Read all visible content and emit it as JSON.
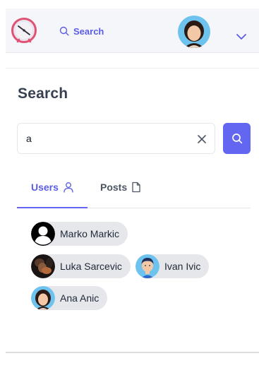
{
  "navbar": {
    "logo_icon": "clock-icon",
    "search_label": "Search",
    "search_icon": "search-icon",
    "avatar_icon": "user-avatar",
    "menu_icon": "chevron-down-icon"
  },
  "page": {
    "title": "Search"
  },
  "search": {
    "value": "a",
    "placeholder": "",
    "clear_icon": "close-icon",
    "submit_icon": "search-icon"
  },
  "tabs": [
    {
      "label": "Users",
      "icon": "user-icon",
      "active": true
    },
    {
      "label": "Posts",
      "icon": "document-icon",
      "active": false
    }
  ],
  "results": [
    {
      "name": "Marko Markic",
      "avatar": "default-avatar"
    },
    {
      "name": "Luka Sarcevic",
      "avatar": "photo-avatar"
    },
    {
      "name": "Ivan Ivic",
      "avatar": "cartoon-boy-avatar"
    },
    {
      "name": "Ana Anic",
      "avatar": "cartoon-girl-avatar"
    }
  ],
  "colors": {
    "accent": "#6366f1",
    "logo_ring": "#e05273",
    "chip_bg": "#e5e7eb",
    "nav_bg": "#f5f6fa"
  }
}
